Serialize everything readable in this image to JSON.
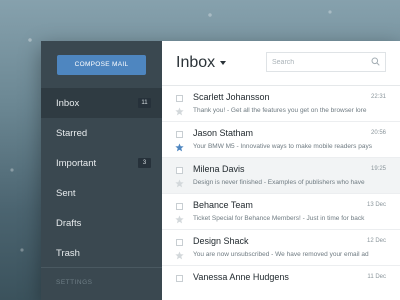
{
  "sidebar": {
    "compose_label": "COMPOSE MAIL",
    "items": [
      {
        "label": "Inbox",
        "count": "11"
      },
      {
        "label": "Starred",
        "count": ""
      },
      {
        "label": "Important",
        "count": "3"
      },
      {
        "label": "Sent",
        "count": ""
      },
      {
        "label": "Drafts",
        "count": ""
      },
      {
        "label": "Trash",
        "count": ""
      }
    ],
    "settings_label": "SETTINGS"
  },
  "header": {
    "title": "Inbox",
    "search_placeholder": "Search"
  },
  "colors": {
    "accent": "#4e86c0",
    "sidebar_bg": "#3a4850",
    "star_active": "#4e86c0",
    "star_inactive": "#d3d8db"
  },
  "emails": [
    {
      "sender": "Scarlett Johansson",
      "time": "22:31",
      "preview": "Thank you! - Get all the features you get on the browser lore",
      "starred": false
    },
    {
      "sender": "Jason Statham",
      "time": "20:56",
      "preview": "Your BMW M5 - Innovative ways to make mobile readers pays",
      "starred": true
    },
    {
      "sender": "Milena Davis",
      "time": "19:25",
      "preview": "Design is never finished - Examples of publishers who have",
      "starred": false
    },
    {
      "sender": "Behance Team",
      "time": "13 Dec",
      "preview": "Ticket Special for Behance Members! - Just in time for back",
      "starred": false
    },
    {
      "sender": "Design Shack",
      "time": "12 Dec",
      "preview": "You are now unsubscribed - We have removed your email ad",
      "starred": false
    },
    {
      "sender": "Vanessa Anne Hudgens",
      "time": "11 Dec",
      "preview": "",
      "starred": false
    }
  ]
}
